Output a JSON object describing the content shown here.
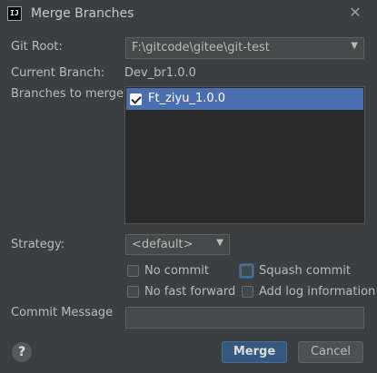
{
  "window": {
    "title": "Merge Branches",
    "app_icon_text": "IJ"
  },
  "form": {
    "git_root_label": "Git Root:",
    "git_root_value": "F:\\gitcode\\gitee\\git-test",
    "current_branch_label": "Current Branch:",
    "current_branch_value": "Dev_br1.0.0",
    "branches_label": "Branches to merge:",
    "branches": [
      {
        "name": "Ft_ziyu_1.0.0",
        "checked": true
      }
    ],
    "strategy_label": "Strategy:",
    "strategy_value": "<default>",
    "options": {
      "no_commit": "No commit",
      "squash_commit": "Squash commit",
      "no_fast_forward": "No fast forward",
      "add_log_information": "Add log information"
    },
    "commit_message_label": "Commit Message",
    "commit_message_value": ""
  },
  "footer": {
    "help_label": "?",
    "merge_label": "Merge",
    "cancel_label": "Cancel"
  },
  "colors": {
    "background": "#3c3f41",
    "selection": "#4b6eaf",
    "primary_button": "#365880"
  }
}
